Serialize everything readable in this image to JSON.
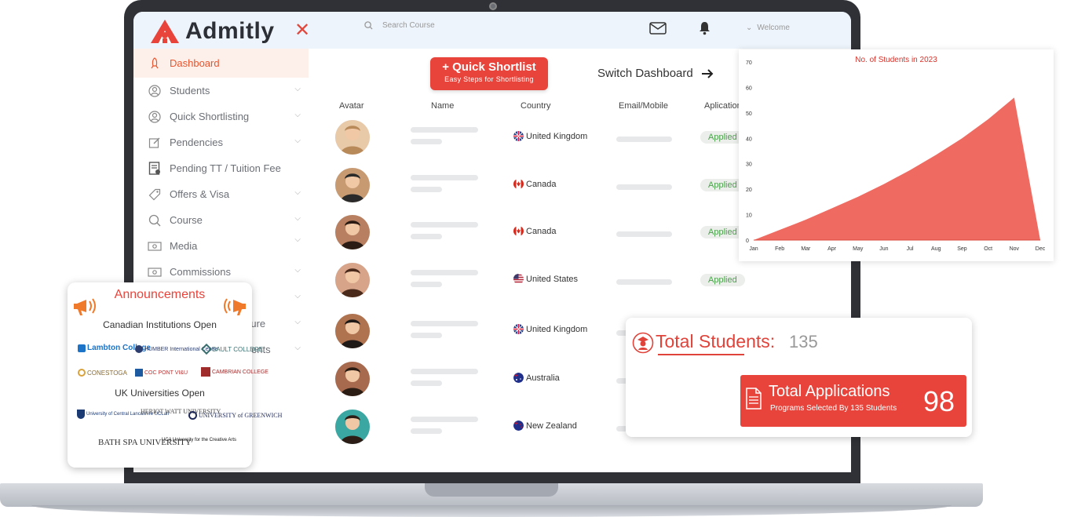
{
  "app": {
    "brand": "Admitly",
    "search_placeholder": "Search Course",
    "welcome": "Welcome"
  },
  "sidebar": {
    "items": [
      {
        "label": "Dashboard",
        "icon": "rocket-icon",
        "active": true
      },
      {
        "label": "Students",
        "icon": "user-icon"
      },
      {
        "label": "Quick Shortlisting",
        "icon": "user-icon"
      },
      {
        "label": "Pendencies",
        "icon": "edit-icon"
      },
      {
        "label": "Pending TT / Tuition Fee",
        "icon": "receipt-icon"
      },
      {
        "label": "Offers & Visa",
        "icon": "tag-icon"
      },
      {
        "label": "Course",
        "icon": "search-icon"
      },
      {
        "label": "Media",
        "icon": "media-icon"
      },
      {
        "label": "Commissions",
        "icon": "money-icon"
      },
      {
        "label": "",
        "icon": ""
      },
      {
        "label": "ucture",
        "icon": ""
      },
      {
        "label": "ements",
        "icon": ""
      }
    ]
  },
  "main": {
    "quick_shortlist_label": "+ Quick Shortlist",
    "quick_shortlist_sub": "Easy Steps for Shortlisting",
    "switch_dashboard": "Switch Dashboard",
    "columns": [
      "Avatar",
      "Name",
      "Country",
      "Email/Mobile",
      "Aplication"
    ],
    "rows": [
      {
        "country": "United Kingdom",
        "flag": "uk",
        "status": "Applied"
      },
      {
        "country": "Canada",
        "flag": "ca",
        "status": "Applied"
      },
      {
        "country": "Canada",
        "flag": "ca",
        "status": "Applied"
      },
      {
        "country": "United States",
        "flag": "us",
        "status": "Applied"
      },
      {
        "country": "United Kingdom",
        "flag": "uk",
        "status": ""
      },
      {
        "country": "Australia",
        "flag": "au",
        "status": ""
      },
      {
        "country": "New Zealand",
        "flag": "nz",
        "status": ""
      }
    ]
  },
  "chart_data": {
    "type": "area",
    "title": "No. of Students in 2023",
    "categories": [
      "Jan",
      "Feb",
      "Mar",
      "Apr",
      "May",
      "Jun",
      "Jul",
      "Aug",
      "Sep",
      "Oct",
      "Nov",
      "Dec"
    ],
    "values": [
      0,
      4,
      8,
      12.5,
      17,
      22,
      27.5,
      33.5,
      40,
      47.5,
      56,
      0
    ],
    "ylim": [
      0,
      70
    ],
    "yticks": [
      0,
      10,
      20,
      30,
      40,
      50,
      60,
      70
    ],
    "color": "#ef6a60"
  },
  "announcements": {
    "title": "Announcements",
    "canada_heading": "Canadian Institutions Open",
    "canada_logos": [
      "Lambton College",
      "HUMBER International Centre",
      "SAULT COLLEGE",
      "CONESTOGA",
      "COC PONT VI&U",
      "CAMBRIAN COLLEGE"
    ],
    "uk_heading": "UK Universities Open",
    "uk_logos": [
      "University of Central Lancashire UCLan",
      "HERIOT WATT UNIVERSITY",
      "UNIVERSITY of GREENWICH",
      "BATH SPA UNIVERSITY",
      "UCA University for the Creative Arts"
    ]
  },
  "totals": {
    "students_label": "Total Students:",
    "students_value": "135",
    "applications_label": "Total Applications",
    "applications_sub": "Programs Selected By 135 Students",
    "applications_value": "98"
  }
}
